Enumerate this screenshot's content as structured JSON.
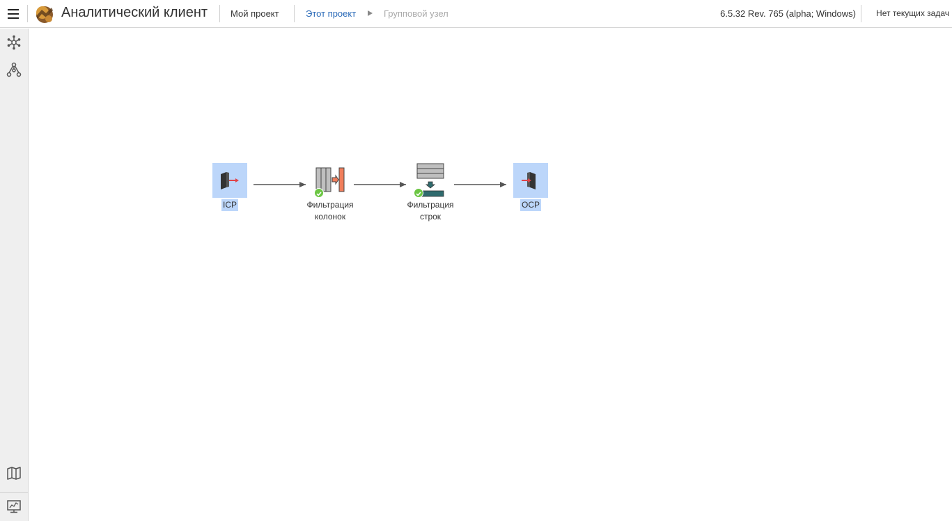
{
  "header": {
    "app_title": "Аналитический клиент",
    "my_project": "Мой проект",
    "breadcrumb": [
      "Этот проект",
      "Групповой узел"
    ],
    "version": "6.5.32 Rev. 765 (alpha; Windows)",
    "tasks": "Нет текущих задач",
    "menu_icon": "hamburger-menu-icon",
    "logo_icon": "app-logo-icon"
  },
  "sidebar": {
    "items": [
      {
        "icon": "nodes-snowflake-icon"
      },
      {
        "icon": "workflow-tree-icon"
      },
      {
        "icon": "map-icon"
      },
      {
        "icon": "monitor-chart-icon"
      }
    ]
  },
  "workflow": {
    "nodes": [
      {
        "id": "icp",
        "label": "ICP",
        "selected": true,
        "status": ""
      },
      {
        "id": "column_filter",
        "label_line1": "Фильтрация",
        "label_line2": "колонок",
        "status": "ok"
      },
      {
        "id": "row_filter",
        "label_line1": "Фильтрация",
        "label_line2": "строк",
        "status": "ok"
      },
      {
        "id": "ocp",
        "label": "OCP",
        "selected": true,
        "status": ""
      }
    ]
  },
  "colors": {
    "accent_link": "#2a6ab8",
    "selection": "#bcd6fa",
    "status_ok": "#6cc644"
  }
}
